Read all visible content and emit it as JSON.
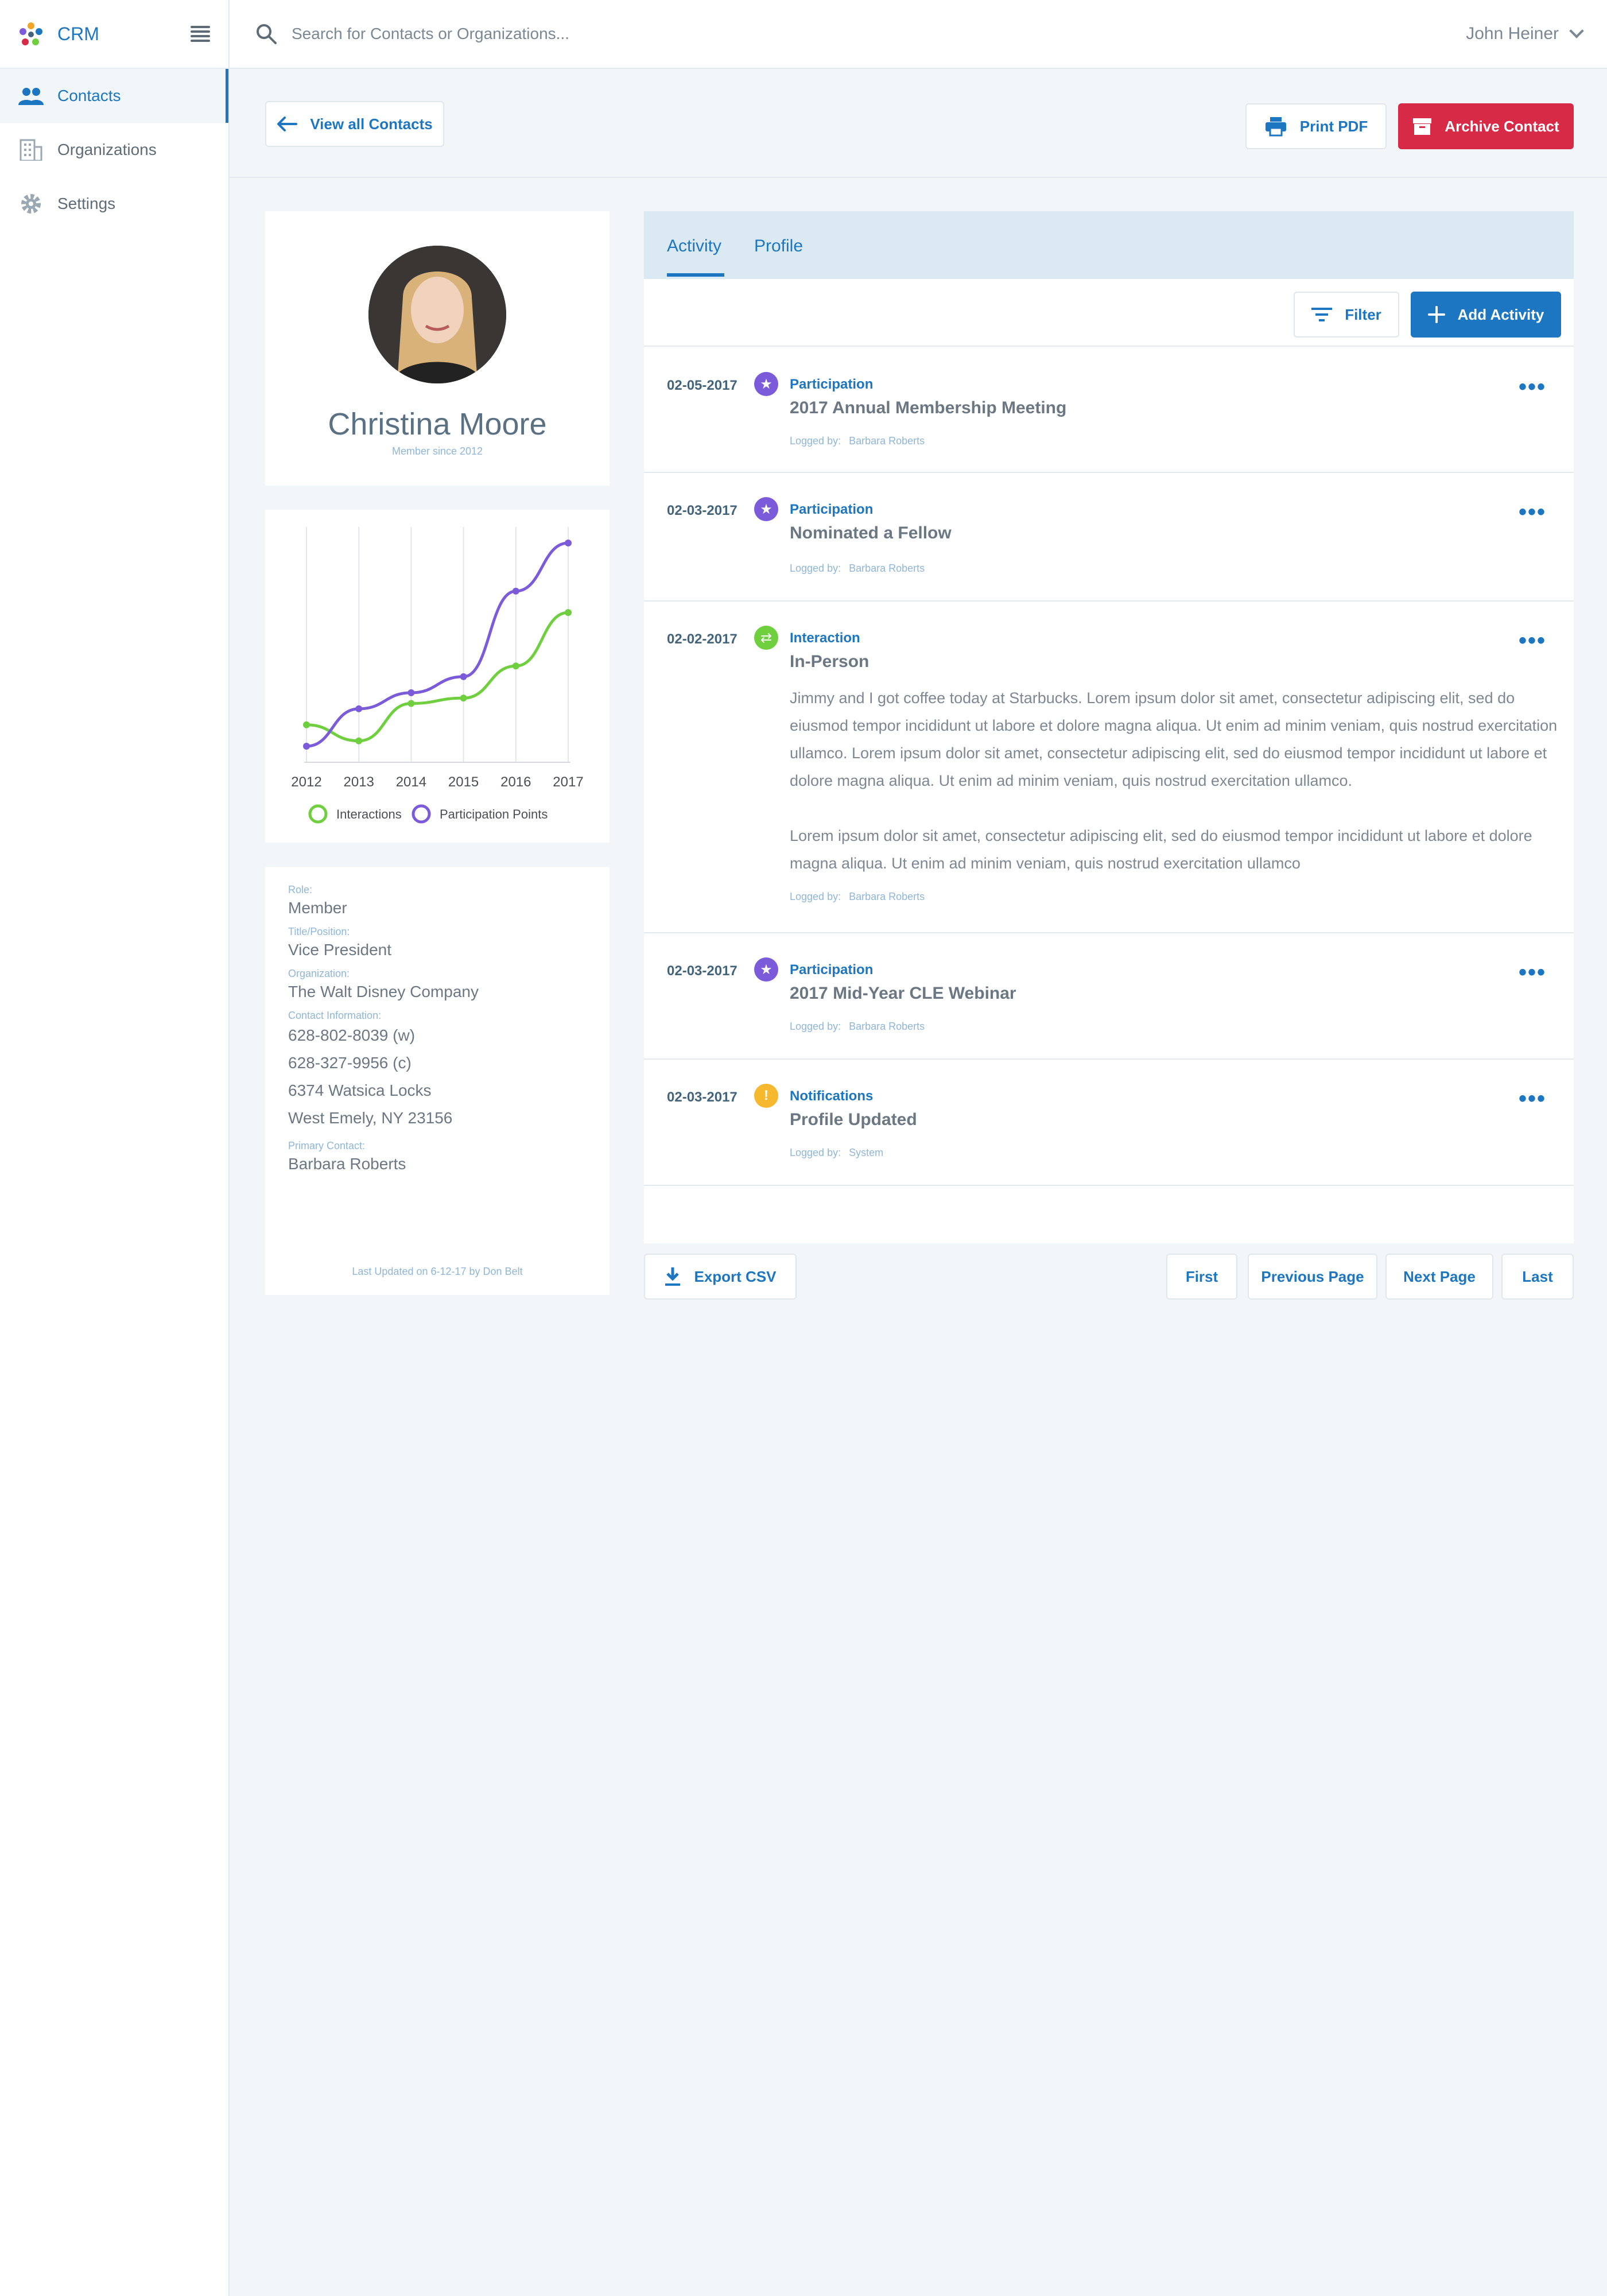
{
  "app": {
    "name": "CRM"
  },
  "sidebar": {
    "items": [
      {
        "label": "Contacts",
        "icon": "people-icon",
        "active": true
      },
      {
        "label": "Organizations",
        "icon": "building-icon",
        "active": false
      },
      {
        "label": "Settings",
        "icon": "gear-icon",
        "active": false
      }
    ]
  },
  "search": {
    "placeholder": "Search for Contacts or Organizations..."
  },
  "user": {
    "name": "John Heiner"
  },
  "actions": {
    "back_label": "View all Contacts",
    "print_label": "Print PDF",
    "archive_label": "Archive Contact"
  },
  "profile": {
    "name": "Christina Moore",
    "member_since": "Member since 2012"
  },
  "chart_data": {
    "type": "line",
    "x": [
      "2012",
      "2013",
      "2014",
      "2015",
      "2016",
      "2017"
    ],
    "series": [
      {
        "name": "Interactions",
        "color": "#6fcf3e",
        "values": [
          7,
          4,
          11,
          12,
          18,
          28
        ]
      },
      {
        "name": "Participation Points",
        "color": "#7b5bd9",
        "values": [
          3,
          10,
          13,
          16,
          32,
          41
        ]
      }
    ],
    "ylim": [
      0,
      44
    ],
    "grid": "vertical",
    "legend": "bottom"
  },
  "info": {
    "role_label": "Role:",
    "role": "Member",
    "title_label": "Title/Position:",
    "title": "Vice President",
    "org_label": "Organization:",
    "org": "The Walt Disney Company",
    "contact_label": "Contact Information:",
    "phone_w": "628-802-8039 (w)",
    "phone_c": "628-327-9956 (c)",
    "address1": "6374 Watsica Locks",
    "address2": "West Emely, NY 23156",
    "primary_label": "Primary Contact:",
    "primary": "Barbara Roberts",
    "updated": "Last Updated on 6-12-17 by Don Belt"
  },
  "tabs": {
    "activity": "Activity",
    "profile": "Profile"
  },
  "toolbar": {
    "filter": "Filter",
    "add": "Add Activity"
  },
  "activities": [
    {
      "date": "02-05-2017",
      "type": "Participation",
      "title": "2017 Annual Membership Meeting",
      "logged_label": "Logged by:",
      "logged_by": "Barbara Roberts"
    },
    {
      "date": "02-03-2017",
      "type": "Participation",
      "title": "Nominated a Fellow",
      "logged_label": "Logged by:",
      "logged_by": "Barbara Roberts"
    },
    {
      "date": "02-02-2017",
      "type": "Interaction",
      "title": "In-Person",
      "body1": "Jimmy and I got coffee today at Starbucks. Lorem ipsum dolor sit amet, consectetur adipiscing elit, sed do eiusmod tempor incididunt ut labore et dolore magna aliqua. Ut enim ad minim veniam, quis nostrud exercitation ullamco. Lorem ipsum dolor sit amet, consectetur adipiscing elit, sed do eiusmod tempor incididunt ut labore et dolore magna aliqua. Ut enim ad minim veniam, quis nostrud exercitation ullamco.",
      "body2": "Lorem ipsum dolor sit amet, consectetur adipiscing elit, sed do eiusmod tempor incididunt ut labore et dolore magna aliqua. Ut enim ad minim veniam, quis nostrud exercitation ullamco",
      "logged_label": "Logged by:",
      "logged_by": "Barbara Roberts"
    },
    {
      "date": "02-03-2017",
      "type": "Participation",
      "title": "2017 Mid-Year CLE Webinar",
      "logged_label": "Logged by:",
      "logged_by": "Barbara Roberts"
    },
    {
      "date": "02-03-2017",
      "type": "Notifications",
      "title": "Profile Updated",
      "logged_label": "Logged by:",
      "logged_by": "System"
    }
  ],
  "more_label": "•••",
  "footer": {
    "export": "Export CSV",
    "first": "First",
    "prev": "Previous Page",
    "next": "Next Page",
    "last": "Last"
  },
  "colors": {
    "accent": "#1c76c2",
    "danger": "#d62a47",
    "participation": "#7b5bd9",
    "interaction": "#6fcf3e",
    "notification": "#f5b82e"
  }
}
